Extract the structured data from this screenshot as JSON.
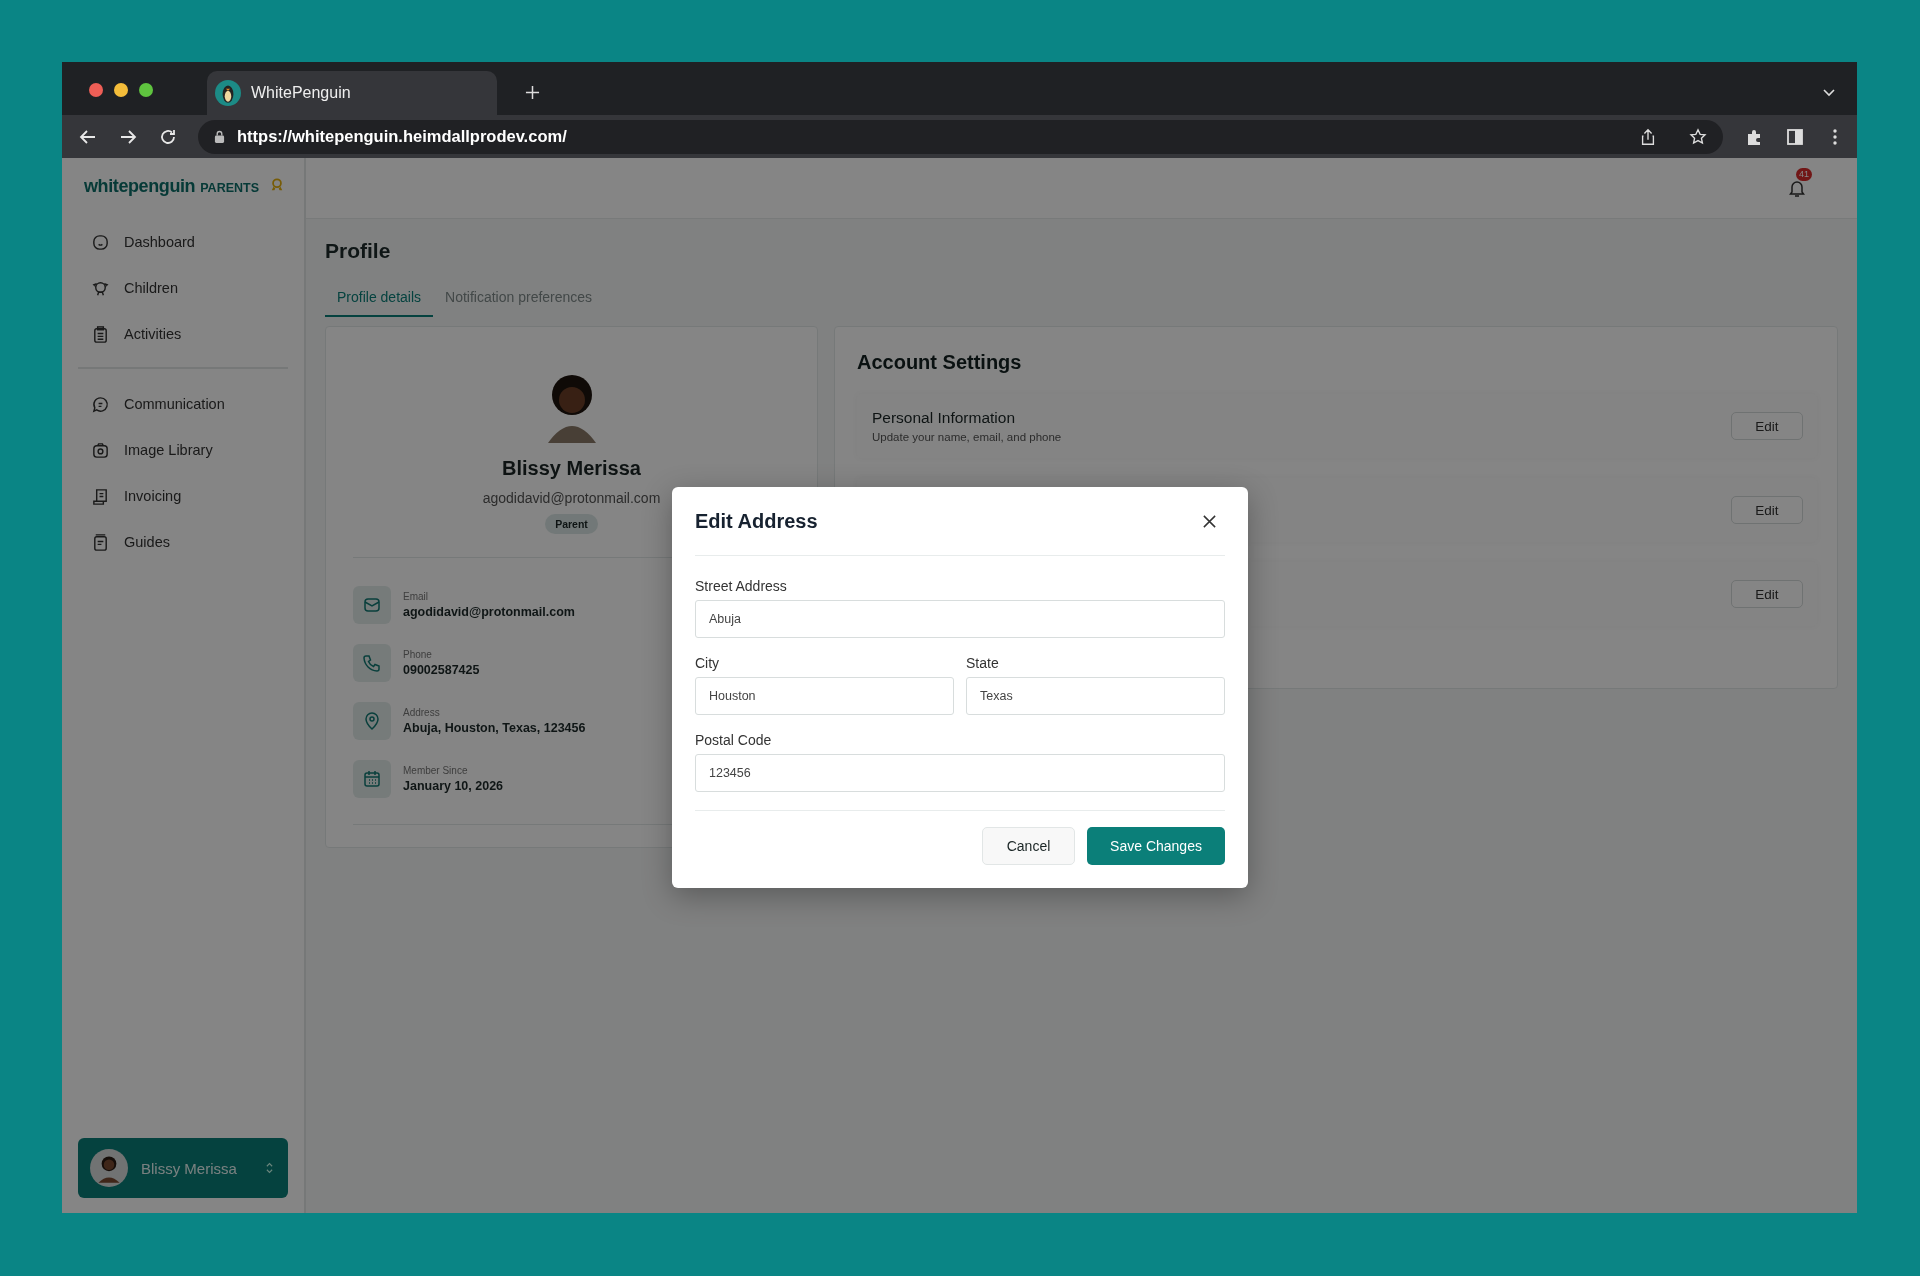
{
  "browser": {
    "tab_title": "WhitePenguin",
    "url": "https://whitepenguin.heimdallprodev.com/"
  },
  "sidebar": {
    "logo": "whitepenguin",
    "logo_suffix": "PARENTS",
    "nav_groups": [
      [
        {
          "label": "Dashboard"
        },
        {
          "label": "Children"
        },
        {
          "label": "Activities"
        }
      ],
      [
        {
          "label": "Communication"
        },
        {
          "label": "Image Library"
        },
        {
          "label": "Invoicing"
        },
        {
          "label": "Guides"
        }
      ]
    ],
    "user": {
      "name": "Blissy Merissa"
    }
  },
  "header": {
    "notification_count": "41"
  },
  "page": {
    "title": "Profile",
    "tabs": [
      {
        "label": "Profile details",
        "selected": true
      },
      {
        "label": "Notification preferences",
        "selected": false
      }
    ],
    "profile": {
      "name": "Blissy Merissa",
      "email": "agodidavid@protonmail.com",
      "role": "Parent",
      "details": [
        {
          "label": "Email",
          "value": "agodidavid@protonmail.com"
        },
        {
          "label": "Phone",
          "value": "09002587425"
        },
        {
          "label": "Address",
          "value": "Abuja, Houston, Texas, 123456"
        },
        {
          "label": "Member Since",
          "value": "January 10, 2026"
        }
      ]
    },
    "account_settings": {
      "title": "Account Settings",
      "sections": [
        {
          "title": "Personal Information",
          "subtitle": "Update your name, email, and phone",
          "button": "Edit"
        },
        {
          "button": "Edit"
        },
        {
          "button": "Edit"
        }
      ]
    }
  },
  "modal": {
    "title": "Edit Address",
    "rows": [
      [
        {
          "label": "Street Address",
          "value": "Abuja"
        }
      ],
      [
        {
          "label": "City",
          "value": "Houston"
        },
        {
          "label": "State",
          "value": "Texas"
        }
      ],
      [
        {
          "label": "Postal Code",
          "value": "123456"
        }
      ]
    ],
    "cancel": "Cancel",
    "save": "Save Changes"
  }
}
